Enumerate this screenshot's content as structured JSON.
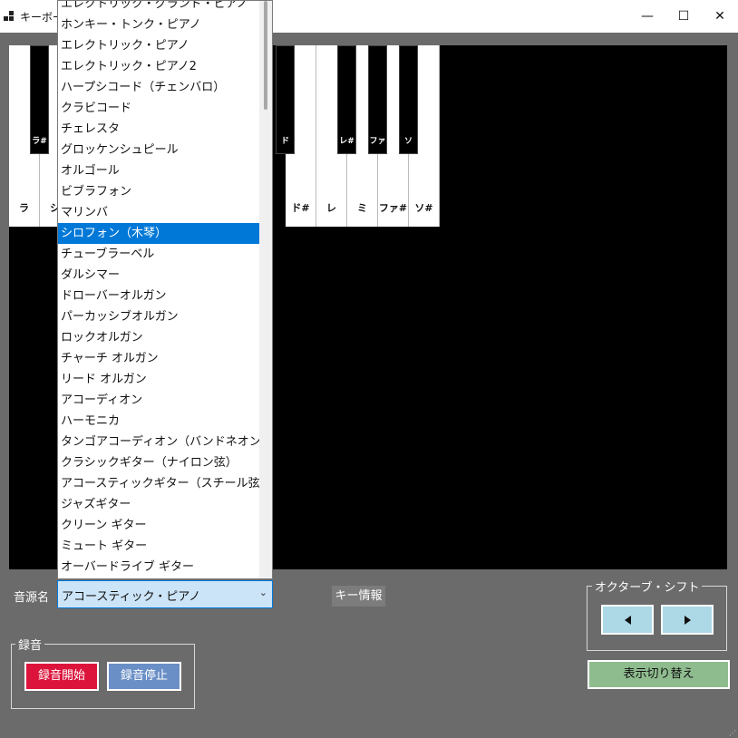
{
  "window": {
    "title": "キーボード・ピアノ",
    "buttons": {
      "minimize": "—",
      "maximize": "☐",
      "close": "✕"
    }
  },
  "keyboard": {
    "white_keys": [
      {
        "label": "ラ"
      },
      {
        "label": "シ"
      },
      {
        "label": ""
      },
      {
        "label": ""
      },
      {
        "label": ""
      },
      {
        "label": ""
      },
      {
        "label": ""
      },
      {
        "label": ""
      },
      {
        "label": "ド#"
      },
      {
        "label": "レ"
      },
      {
        "label": "ミ"
      },
      {
        "label": "ファ#"
      },
      {
        "label": "ソ#"
      }
    ],
    "black_keys": [
      {
        "label": "ラ#"
      },
      {
        "label": "ド"
      },
      {
        "label": "レ#"
      },
      {
        "label": "ファ"
      },
      {
        "label": "ソ"
      }
    ]
  },
  "instrument_list": {
    "items": [
      "エレクトリック・グランド・ピアノ",
      "ホンキー・トンク・ピアノ",
      "エレクトリック・ピアノ",
      "エレクトリック・ピアノ2",
      "ハープシコード（チェンバロ）",
      "クラビコード",
      "チェレスタ",
      "グロッケンシュピール",
      "オルゴール",
      "ビブラフォン",
      "マリンバ",
      "シロフォン（木琴）",
      "チューブラーベル",
      "ダルシマー",
      "ドローバーオルガン",
      "パーカッシブオルガン",
      "ロックオルガン",
      "チャーチ オルガン",
      "リード オルガン",
      "アコーディオン",
      "ハーモニカ",
      "タンゴアコーディオン（バンドネオン）",
      "クラシックギター（ナイロン弦）",
      "アコースティックギター（スチール弦）",
      "ジャズギター",
      "クリーン ギター",
      "ミュート ギター",
      "オーバードライブ ギター"
    ],
    "selected_index": 11
  },
  "source": {
    "label": "音源名",
    "value": "アコースティック・ピアノ"
  },
  "key_info_button": "キー情報",
  "octave_shift": {
    "legend": "オクターブ・シフト",
    "left_icon": "triangle-left-icon",
    "right_icon": "triangle-right-icon"
  },
  "display_toggle_button": "表示切り替え",
  "recording": {
    "legend": "録音",
    "start_button": "録音開始",
    "stop_button": "録音停止"
  },
  "colors": {
    "selection": "#0078d7",
    "record_start": "#dc143c",
    "record_stop": "#6a8fc6",
    "octave_buttons": "#add8e6",
    "display_toggle": "#8fbc8f"
  }
}
